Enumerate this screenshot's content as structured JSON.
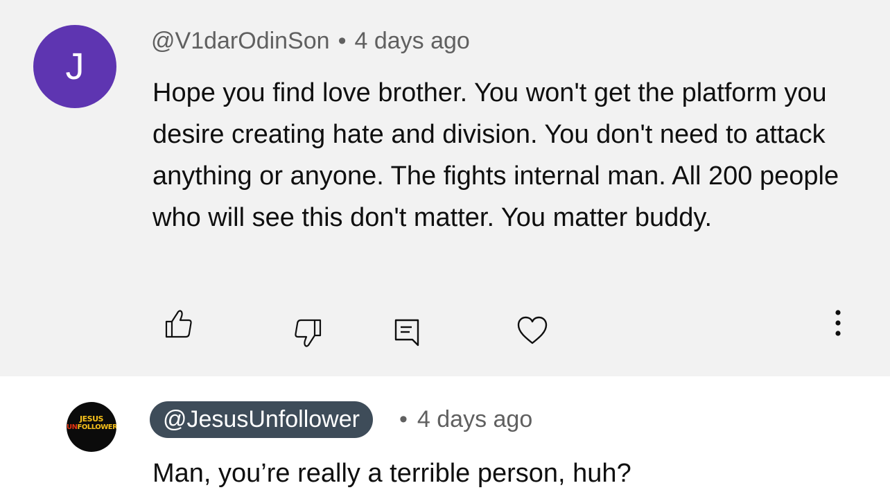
{
  "comments": [
    {
      "avatar_letter": "J",
      "avatar_color": "#5e35b1",
      "author": "@V1darOdinSon",
      "separator": "•",
      "time": "4 days ago",
      "text": "Hope you find love brother. You won't get the platform you desire creating hate and division. You don't need to attack anything or anyone. The fights internal man. All 200 people who will see this don't matter. You matter buddy.",
      "actions": [
        "like-icon",
        "dislike-icon",
        "reply-icon",
        "heart-icon",
        "more-icon"
      ]
    },
    {
      "avatar_logo": {
        "line1": "JESUS",
        "line2_prefix": "UN",
        "line2_rest": "FOLLOWER"
      },
      "author": "@JesusUnfollower",
      "author_badge_color": "#3e4c59",
      "separator": "•",
      "time": "4 days ago",
      "text": "Man, you’re really a terrible person, huh?"
    }
  ]
}
